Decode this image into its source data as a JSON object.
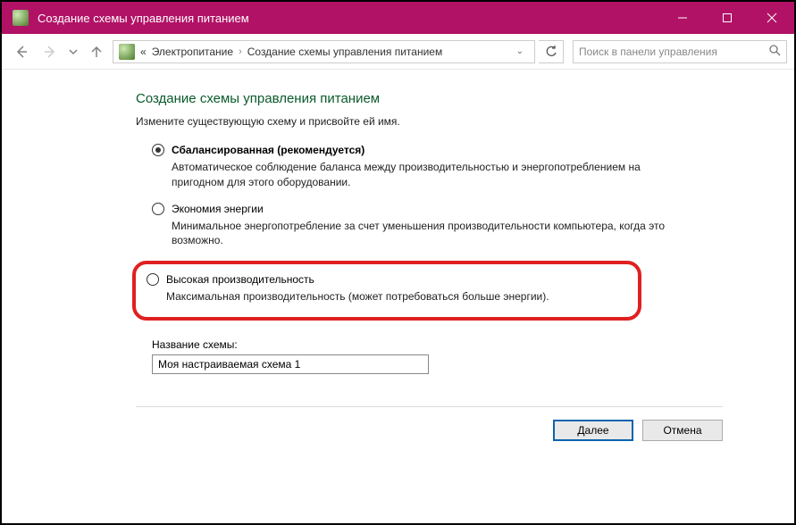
{
  "window": {
    "title": "Создание схемы управления питанием"
  },
  "breadcrumb": {
    "prefix": "«",
    "items": [
      "Электропитание",
      "Создание схемы управления питанием"
    ]
  },
  "search": {
    "placeholder": "Поиск в панели управления"
  },
  "page": {
    "title": "Создание схемы управления питанием",
    "subtitle": "Измените существующую схему и присвойте ей имя."
  },
  "options": [
    {
      "label": "Сбалансированная (рекомендуется)",
      "desc": "Автоматическое соблюдение баланса между производительностью и энергопотреблением на пригодном для этого оборудовании.",
      "checked": true,
      "highlighted": false,
      "bold": true
    },
    {
      "label": "Экономия энергии",
      "desc": "Минимальное энергопотребление за счет уменьшения производительности компьютера, когда это возможно.",
      "checked": false,
      "highlighted": false,
      "bold": false
    },
    {
      "label": "Высокая производительность",
      "desc": "Максимальная производительность (может потребоваться больше энергии).",
      "checked": false,
      "highlighted": true,
      "bold": false
    }
  ],
  "field": {
    "label": "Название схемы:",
    "value": "Моя настраиваемая схема 1"
  },
  "buttons": {
    "next": "Далее",
    "cancel": "Отмена"
  }
}
